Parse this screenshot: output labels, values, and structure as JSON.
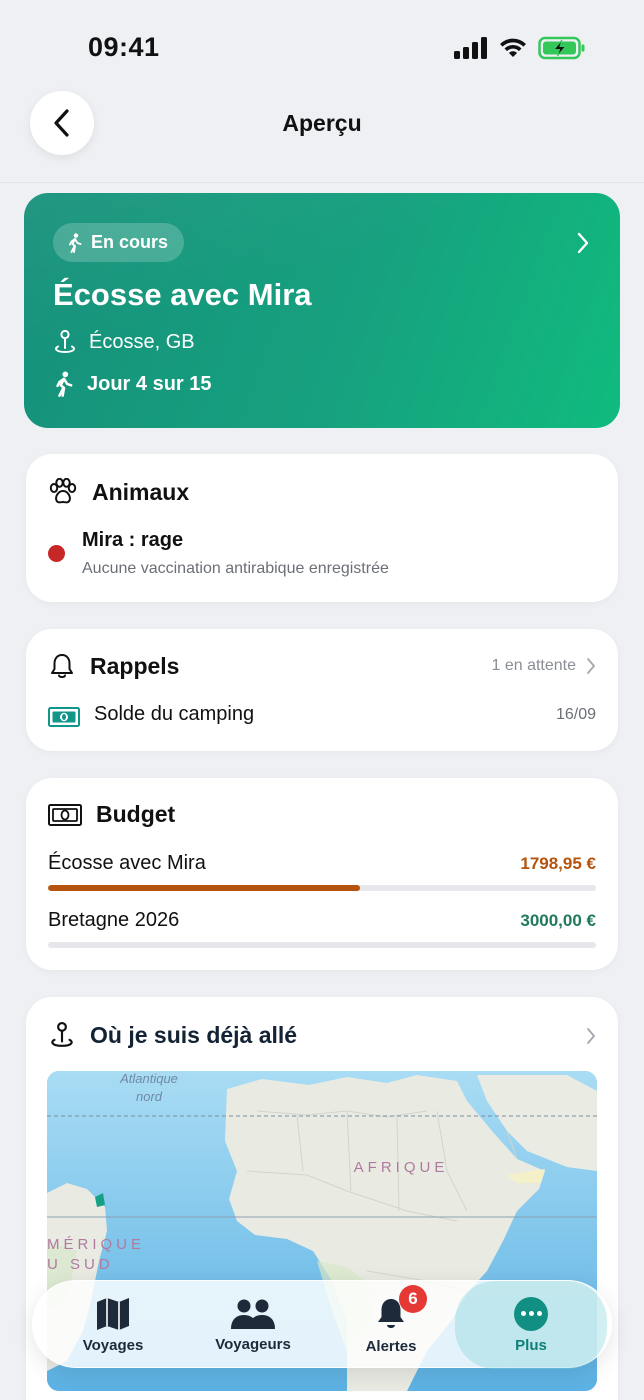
{
  "status_bar": {
    "time": "09:41"
  },
  "header": {
    "title": "Aperçu"
  },
  "trip": {
    "status": "En cours",
    "title": "Écosse avec Mira",
    "location": "Écosse, GB",
    "day": "Jour 4 sur 15"
  },
  "animals": {
    "title": "Animaux",
    "items": [
      {
        "name": "Mira : rage",
        "detail": "Aucune vaccination antirabique enregistrée",
        "status_color": "#c62828"
      }
    ]
  },
  "reminders": {
    "title": "Rappels",
    "pending": "1 en attente",
    "items": [
      {
        "label": "Solde du camping",
        "date": "16/09"
      }
    ]
  },
  "budget": {
    "title": "Budget",
    "items": [
      {
        "label": "Écosse avec Mira",
        "amount": "1798,95 €",
        "progress": 0.57,
        "color": "#b5540f"
      },
      {
        "label": "Bretagne 2026",
        "amount": "3000,00 €",
        "progress": 0,
        "color": "#1f7a5a"
      }
    ]
  },
  "visited": {
    "title": "Où je suis déjà allé",
    "map_labels": {
      "ocean": "Atlantique nord",
      "africa": "AFRIQUE",
      "america": "MÉRIQUE DU SUD"
    }
  },
  "tabbar": {
    "items": [
      {
        "label": "Voyages",
        "icon": "map-icon"
      },
      {
        "label": "Voyageurs",
        "icon": "people-icon"
      },
      {
        "label": "Alertes",
        "icon": "bell-icon",
        "badge": "6"
      },
      {
        "label": "Plus",
        "icon": "more-icon",
        "active": true
      }
    ]
  },
  "colors": {
    "accent": "#17a17f",
    "danger": "#c62828",
    "active_tab": "#0f7f77"
  }
}
